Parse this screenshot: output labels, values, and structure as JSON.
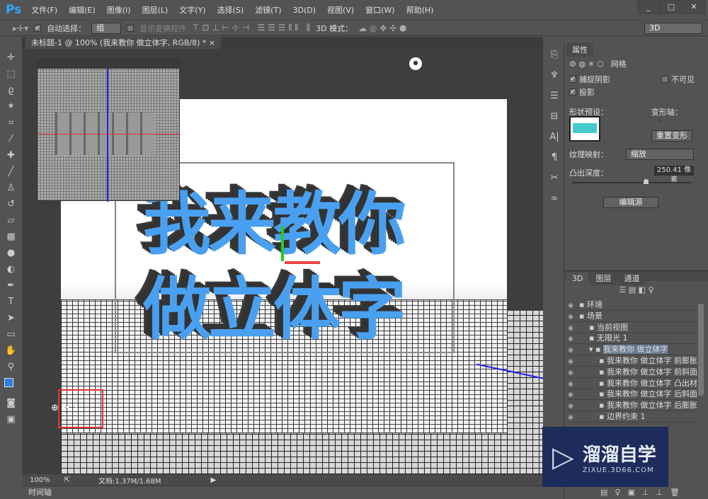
{
  "app": {
    "logo": "Ps"
  },
  "menu": [
    "文件(F)",
    "编辑(E)",
    "图像(I)",
    "图层(L)",
    "文字(Y)",
    "选择(S)",
    "滤镜(T)",
    "3D(D)",
    "视图(V)",
    "窗口(W)",
    "帮助(H)"
  ],
  "window_controls": [
    "_",
    "□",
    "✕"
  ],
  "options": {
    "auto_select_label": "自动选择：",
    "auto_select_value": "组",
    "show_transform": "显示变换控件",
    "mode_label": "3D 模式：",
    "workspace": "3D"
  },
  "document": {
    "tab_title": "未标题-1 @ 100% (我来教你 做立体字, RGB/8) *",
    "close": "×",
    "text_line1": "我来教你",
    "text_line2": "做立体字"
  },
  "status": {
    "zoom": "100%",
    "doc_info": "文档:1.37M/1.68M"
  },
  "timeline": {
    "label": "时间轴"
  },
  "properties": {
    "tab": "属性",
    "mesh_label": "网格",
    "catch_shadows": "捕捉阴影",
    "cast_shadows": "投影",
    "invisible": "不可见",
    "shape_preset": "形状预设：",
    "deform_axis": "变形轴：",
    "reset_deform": "重置变形",
    "texture_map": "纹理映射：",
    "texture_value": "缩放",
    "extrusion_depth": "凸出深度：",
    "extrusion_value": "250.41 像素",
    "extrusion_slider_fraction": 0.6,
    "edit_source": "编辑源"
  },
  "panel3d": {
    "tabs": [
      "3D",
      "图层",
      "通道"
    ],
    "layers": [
      {
        "name": "环境",
        "indent": 0,
        "icon": "environment-icon"
      },
      {
        "name": "场景",
        "indent": 0,
        "icon": "scene-icon"
      },
      {
        "name": "当前视图",
        "indent": 1,
        "icon": "camera-icon"
      },
      {
        "name": "无限光 1",
        "indent": 1,
        "icon": "light-icon"
      },
      {
        "name": "我来教你 做立体字",
        "indent": 1,
        "icon": "mesh-icon",
        "selected": true
      },
      {
        "name": "我来教你 做立体字 前膨胀...",
        "indent": 2,
        "icon": "material-icon"
      },
      {
        "name": "我来教你 做立体字 前斜面...",
        "indent": 2,
        "icon": "material-icon"
      },
      {
        "name": "我来教你 做立体字 凸出材...",
        "indent": 2,
        "icon": "material-icon"
      },
      {
        "name": "我来教你 做立体字 后斜面...",
        "indent": 2,
        "icon": "material-icon"
      },
      {
        "name": "我来教你 做立体字 后膨胀...",
        "indent": 2,
        "icon": "material-icon"
      },
      {
        "name": "边界约束 1",
        "indent": 2,
        "icon": "constraint-icon"
      }
    ]
  },
  "watermark": {
    "title": "溜溜自学",
    "url": "ZIXUE.3D66.COM"
  },
  "colors": {
    "text_blue": "#4aa0f0",
    "accent": "#31a8ff",
    "selected_row": "#6b7b93"
  }
}
